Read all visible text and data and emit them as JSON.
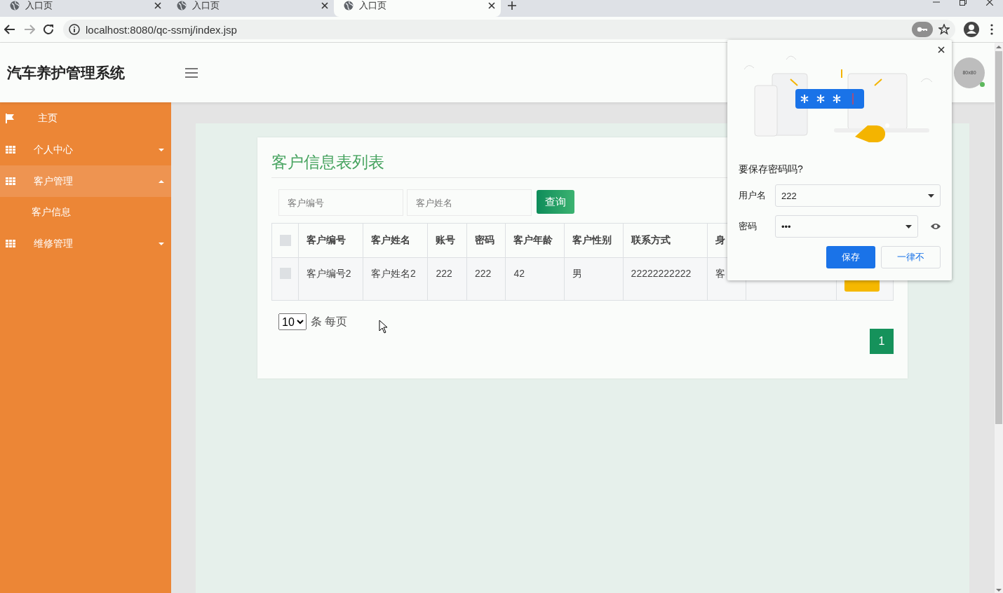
{
  "browser": {
    "tabs": [
      {
        "title": "入口页",
        "selected": false
      },
      {
        "title": "入口页",
        "selected": false
      },
      {
        "title": "入口页",
        "selected": true
      }
    ],
    "address": "localhost:8080/qc-ssmj/index.jsp"
  },
  "header": {
    "title": "汽车养护管理系统",
    "avatar": "80x80"
  },
  "sidebar": {
    "items": [
      {
        "label": "主页",
        "kind": "flag",
        "expanded": false
      },
      {
        "label": "个人中心",
        "kind": "menu",
        "expanded": false
      },
      {
        "label": "客户管理",
        "kind": "menu",
        "expanded": true,
        "children": [
          {
            "label": "客户信息"
          }
        ]
      },
      {
        "label": "维修管理",
        "kind": "menu",
        "expanded": false
      }
    ]
  },
  "content": {
    "title": "客户信息表列表",
    "search": [
      {
        "placeholder": "客户编号"
      },
      {
        "placeholder": "客户姓名"
      }
    ],
    "search_button": "查询",
    "table": {
      "columns": [
        "客户编号",
        "客户姓名",
        "账号",
        "密码",
        "客户年龄",
        "客户性别",
        "联系方式",
        "身"
      ],
      "header_checked": false,
      "rows": [
        {
          "checked": false,
          "cells": [
            "客户编号2",
            "客户姓名2",
            "222",
            "222",
            "42",
            "男",
            "22222222222",
            "客"
          ],
          "has_action": true
        }
      ]
    },
    "page_size": "10",
    "page_size_label": "条 每页",
    "pages": [
      {
        "label": "1",
        "selected": true
      }
    ]
  },
  "password_popup": {
    "title": "要保存密码吗?",
    "username_label": "用户名",
    "username": "222",
    "password_label": "密码",
    "password": "•••",
    "save": "保存",
    "never": "一律不"
  }
}
